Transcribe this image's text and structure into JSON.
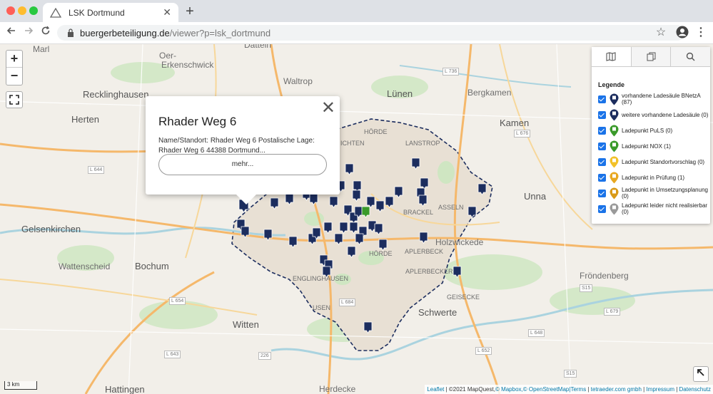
{
  "browser": {
    "tab_title": "LSK Dortmund",
    "tab_close": "✕",
    "new_tab": "+",
    "url_host": "buergerbeteiligung.de",
    "url_path": "/viewer?p=lsk_dortmund"
  },
  "map": {
    "zoom_in": "+",
    "zoom_out": "−",
    "scale": "3 km",
    "places": {
      "marl": "Marl",
      "dattein": "Datteln",
      "oer": "Oer-",
      "erkenschwick": "Erkenschwick",
      "waltrop": "Waltrop",
      "recklinghausen": "Recklinghausen",
      "lunen": "Lünen",
      "bergkamen": "Bergkamen",
      "herten": "Herten",
      "kamen": "Kamen",
      "unna": "Unna",
      "gelsenkirchen": "Gelsenkirchen",
      "bochum": "Bochum",
      "wattenscheid": "Wattenscheid",
      "witten": "Witten",
      "schwerte": "Schwerte",
      "hattingen": "Hattingen",
      "herdecke": "Herdecke",
      "frondenberg": "Fröndenberg",
      "holzwickede": "Holzwickede",
      "horde": "HÖRDE",
      "brackel": "BRACKEL",
      "asseln": "ASSELN",
      "aplerbeck": "APLERBECK",
      "aplerbecker": "APLERBECKER",
      "lanstrop": "LANSTROP",
      "lichten": "ICHTEN",
      "englinghausen": "ENGLINGHAUSEN",
      "husen": "USEN",
      "geisecke": "GEISECKE",
      "horde2": "HÖRDE"
    },
    "roads": [
      "L 736",
      "L 644",
      "L 654",
      "L 676",
      "L 684",
      "L 679",
      "S15",
      "S15",
      "226",
      "L 643",
      "L 652",
      "L 648"
    ]
  },
  "popup": {
    "title": "Rhader Weg 6",
    "body": "Name/Standort: Rhader Weg 6 Postalische Lage: Rhader Weg 6 44388 Dortmund...",
    "button": "mehr...",
    "close": "✕"
  },
  "legend": {
    "title": "Legende",
    "items": [
      {
        "label": "vorhandene Ladesäule BNetzA (87)",
        "color": "#1c2d5e"
      },
      {
        "label": "weitere vorhandene Ladesäule (0)",
        "color": "#1c2d5e"
      },
      {
        "label": "Ladepunkt PuLS (0)",
        "color": "#3a9a2a"
      },
      {
        "label": "Ladepunkt NOX (1)",
        "color": "#3a9a2a"
      },
      {
        "label": "Ladepunkt Standortvorschlag (0)",
        "color": "#f2c128"
      },
      {
        "label": "Ladepunkt in Prüfung (1)",
        "color": "#e8a820"
      },
      {
        "label": "Ladepunkt in Umsetzungsplanung (0)",
        "color": "#d99a18"
      },
      {
        "label": "Ladepunkt leider nicht realisierbar (0)",
        "color": "#9a9a9a"
      }
    ]
  },
  "attribution": {
    "leaflet": "Leaflet",
    "copy": " | ©2021 MapQuest,",
    "mapbox": "© Mapbox,",
    "osm": "© OpenStreetMap",
    "terms": "|Terms",
    "sep1": " | ",
    "tetraeder": "tetraeder.com gmbh",
    "sep2": " | ",
    "impressum": "Impressum",
    "sep3": " | ",
    "datenschutz": "Datenschutz"
  }
}
